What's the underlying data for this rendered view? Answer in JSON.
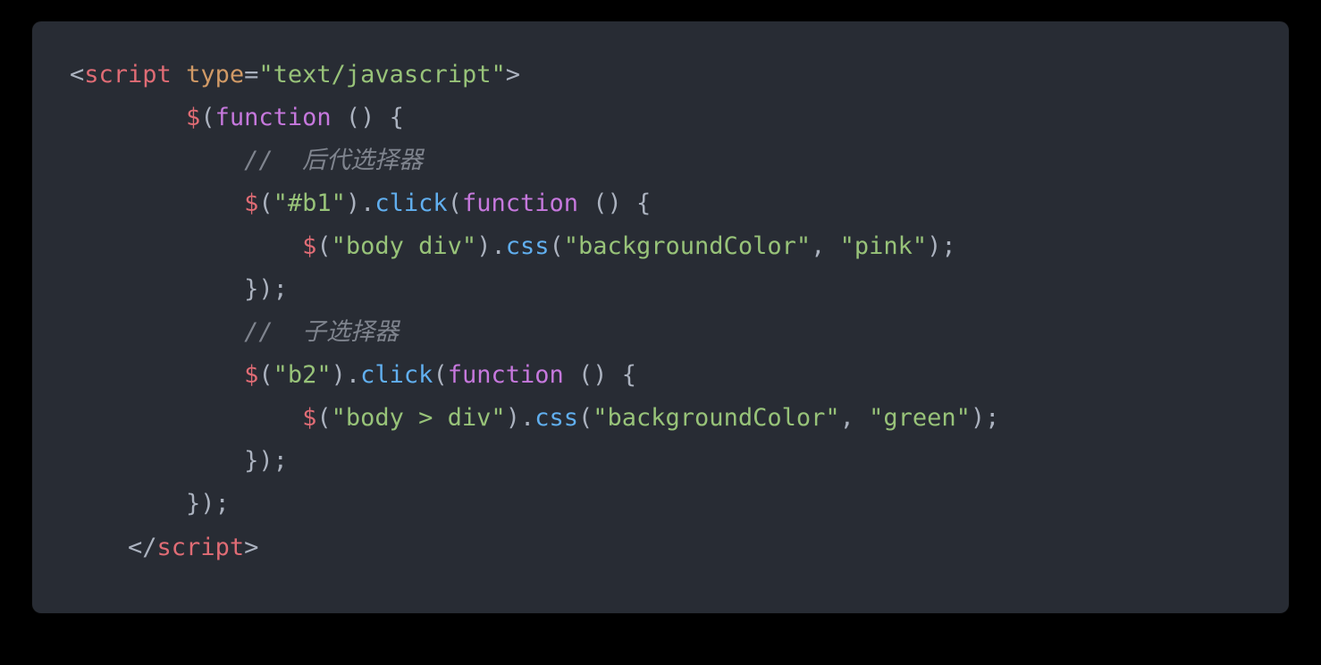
{
  "code": {
    "line1": {
      "open_angle": "<",
      "tag": "script",
      "space": " ",
      "attr": "type",
      "eq": "=",
      "val": "\"text/javascript\"",
      "close_angle": ">"
    },
    "line2": {
      "indent": "        ",
      "dollar": "$",
      "lparen": "(",
      "kw": "function",
      "space_args": " ",
      "args": "()",
      "space_brace": " ",
      "brace": "{"
    },
    "line3": {
      "indent": "            ",
      "comment": "//  后代选择器"
    },
    "line4": {
      "indent": "            ",
      "dollar": "$",
      "lparen": "(",
      "sel": "\"#b1\"",
      "rparen_dot": ").",
      "method": "click",
      "lparen2": "(",
      "kw": "function",
      "space_args": " ",
      "args": "()",
      "space_brace": " ",
      "brace": "{"
    },
    "line5": {
      "indent": "                ",
      "dollar": "$",
      "lparen": "(",
      "sel": "\"body div\"",
      "rparen_dot": ").",
      "method": "css",
      "lparen2": "(",
      "arg1": "\"backgroundColor\"",
      "comma": ", ",
      "arg2": "\"pink\"",
      "rparen_semi": ");"
    },
    "line6": {
      "indent": "            ",
      "close": "});"
    },
    "line7": {
      "indent": "            ",
      "comment": "//  子选择器"
    },
    "line8": {
      "indent": "            ",
      "dollar": "$",
      "lparen": "(",
      "sel": "\"b2\"",
      "rparen_dot": ").",
      "method": "click",
      "lparen2": "(",
      "kw": "function",
      "space_args": " ",
      "args": "()",
      "space_brace": " ",
      "brace": "{"
    },
    "line9": {
      "indent": "                ",
      "dollar": "$",
      "lparen": "(",
      "sel": "\"body > div\"",
      "rparen_dot": ").",
      "method": "css",
      "lparen2": "(",
      "arg1": "\"backgroundColor\"",
      "comma": ", ",
      "arg2": "\"green\"",
      "rparen_semi": ");"
    },
    "line10": {
      "indent": "            ",
      "close": "});"
    },
    "line11": {
      "indent": "        ",
      "close": "});"
    },
    "line12": {
      "indent": "    ",
      "open_angle": "</",
      "tag": "script",
      "close_angle": ">"
    }
  }
}
